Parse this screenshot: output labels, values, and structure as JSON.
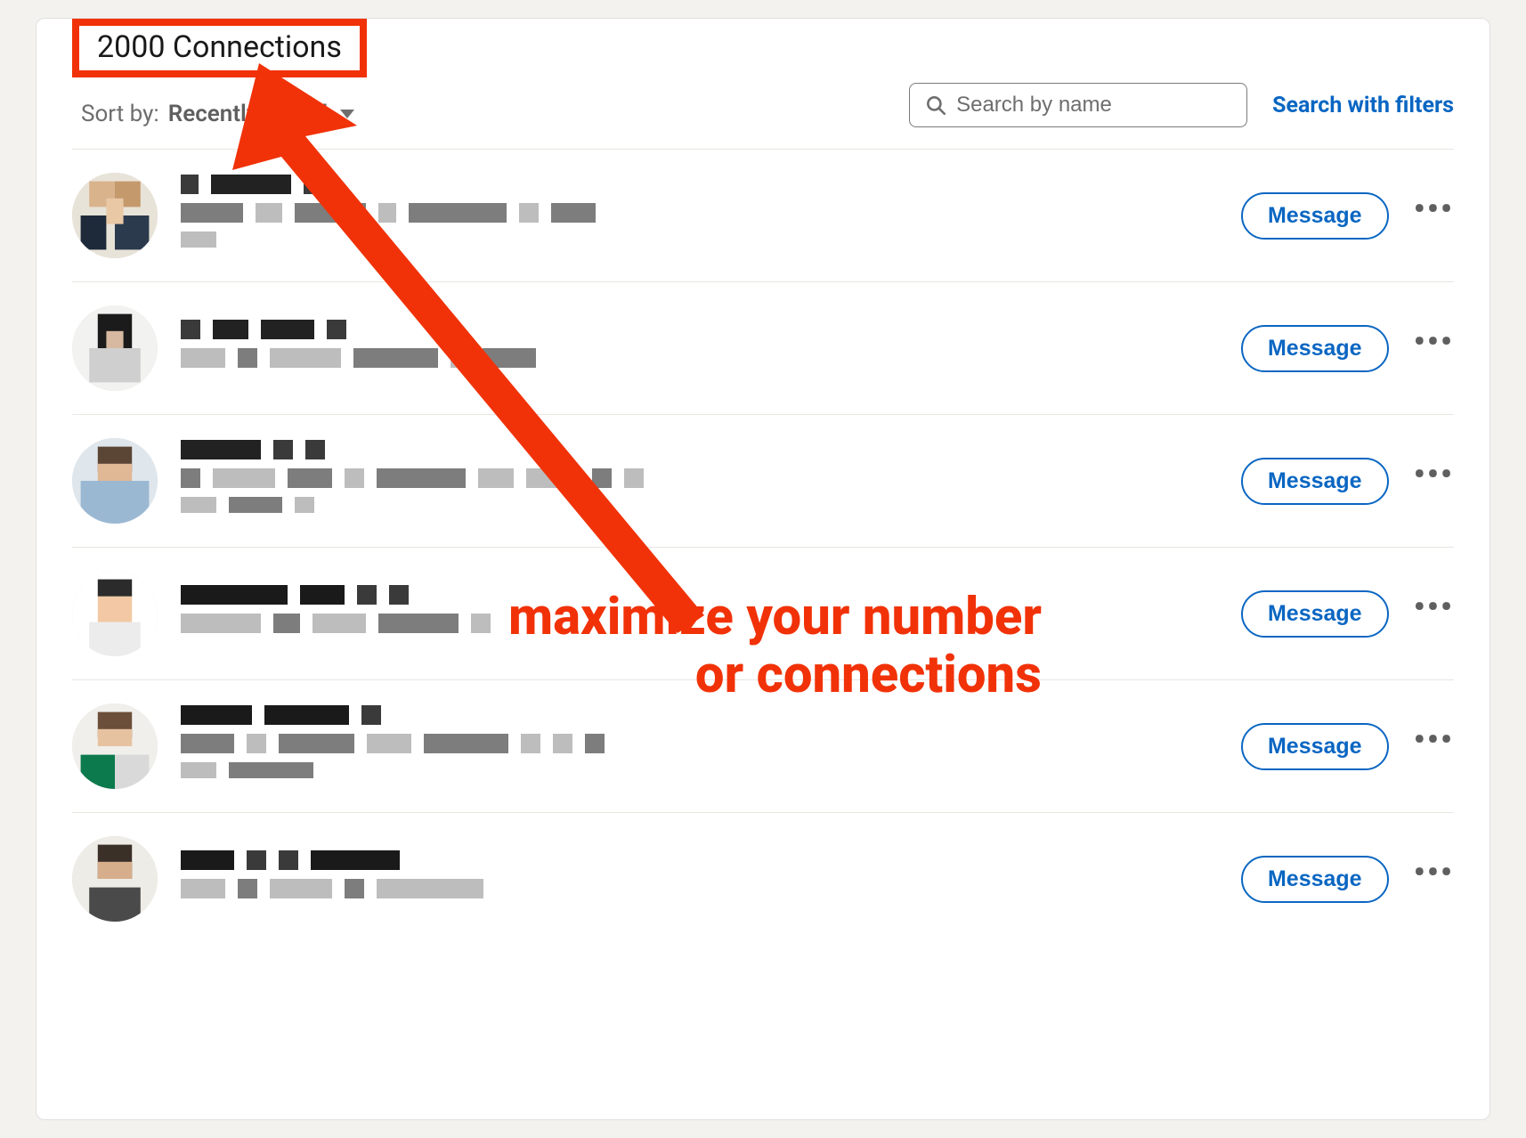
{
  "header": {
    "title": "2000 Connections",
    "sort_label": "Sort by:",
    "sort_value": "Recently added"
  },
  "search": {
    "placeholder": "Search by name",
    "filters_link": "Search with filters"
  },
  "actions": {
    "message_label": "Message"
  },
  "annotation": {
    "text": "maximize your number\nor connections"
  },
  "connections": [
    {
      "id": 1
    },
    {
      "id": 2
    },
    {
      "id": 3
    },
    {
      "id": 4
    },
    {
      "id": 5
    },
    {
      "id": 6
    }
  ]
}
